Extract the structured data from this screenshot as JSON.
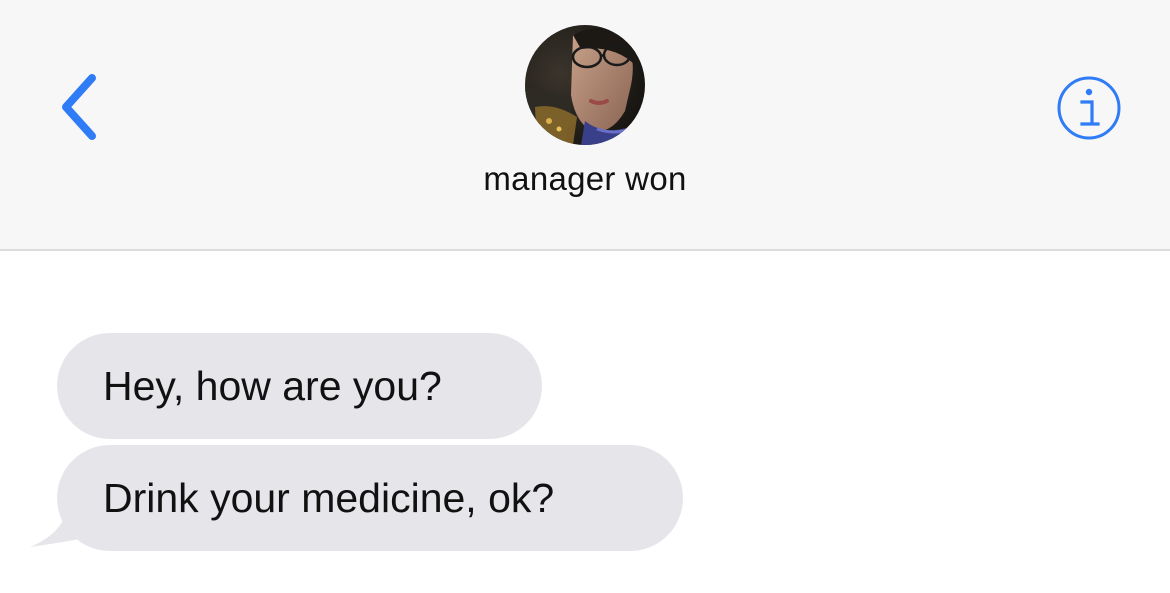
{
  "app": "Messages",
  "header": {
    "back_icon": "chevron-left-icon",
    "contact_name": "manager won",
    "avatar": "contact-photo",
    "info_icon": "info-circle-icon"
  },
  "messages": [
    {
      "direction": "incoming",
      "text": "Hey, how are you?"
    },
    {
      "direction": "incoming",
      "text": "Drink your medicine, ok?"
    }
  ],
  "colors": {
    "accent": "#2f7cf6",
    "header_background": "#f7f7f8",
    "incoming_bubble": "#e6e5ea",
    "text": "#111111"
  }
}
